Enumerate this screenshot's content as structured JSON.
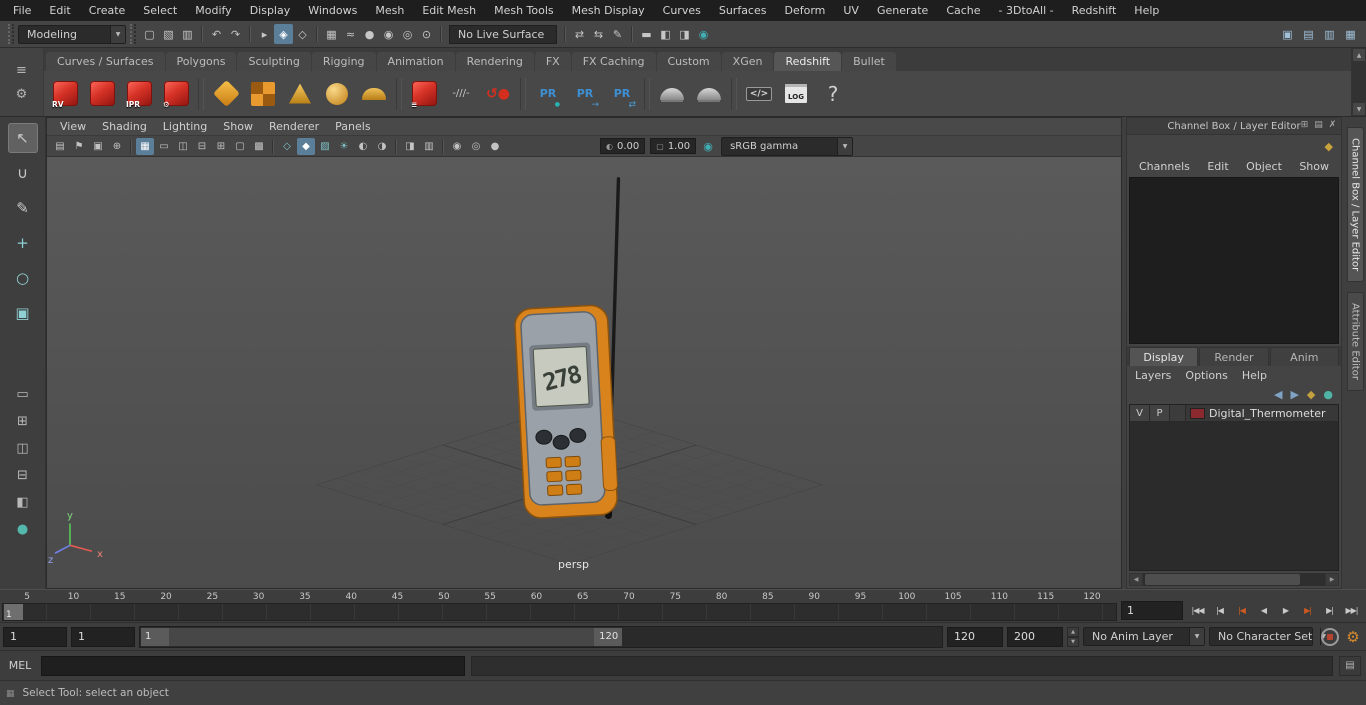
{
  "menu_bar": {
    "items": [
      "File",
      "Edit",
      "Create",
      "Select",
      "Modify",
      "Display",
      "Windows",
      "Mesh",
      "Edit Mesh",
      "Mesh Tools",
      "Mesh Display",
      "Curves",
      "Surfaces",
      "Deform",
      "UV",
      "Generate",
      "Cache",
      "- 3DtoAll -",
      "Redshift",
      "Help"
    ]
  },
  "status_line": {
    "menu_set": "Modeling",
    "live_surface": "No Live Surface",
    "icons_a": [
      {
        "name": "file-new-icon",
        "glyph": "▢"
      },
      {
        "name": "file-open-icon",
        "glyph": "▧"
      },
      {
        "name": "file-save-icon",
        "glyph": "▥"
      },
      {
        "sep": true
      },
      {
        "name": "undo-icon",
        "glyph": "↶"
      },
      {
        "name": "redo-icon",
        "glyph": "↷"
      },
      {
        "sep": true
      },
      {
        "name": "select-hierarchy-mode-icon",
        "glyph": "▸"
      },
      {
        "name": "select-object-mode-icon",
        "glyph": "◈",
        "active": true
      },
      {
        "name": "select-component-mode-icon",
        "glyph": "◇"
      },
      {
        "sep": true
      },
      {
        "name": "snap-to-grid-icon",
        "glyph": "▦"
      },
      {
        "name": "snap-to-curve-icon",
        "glyph": "≈"
      },
      {
        "name": "snap-to-point-icon",
        "glyph": "●"
      },
      {
        "name": "snap-to-projected-center-icon",
        "glyph": "◉"
      },
      {
        "name": "snap-to-view-plane-icon",
        "glyph": "◎"
      },
      {
        "name": "make-live-icon",
        "glyph": "⊙"
      },
      {
        "sep": true
      }
    ],
    "icons_b": [
      {
        "sep": true
      },
      {
        "name": "input-connections-icon",
        "glyph": "⇄"
      },
      {
        "name": "output-connections-icon",
        "glyph": "⇆"
      },
      {
        "name": "construction-history-icon",
        "glyph": "✎"
      },
      {
        "sep": true
      },
      {
        "name": "open-render-view-icon",
        "glyph": "▬"
      },
      {
        "name": "render-current-frame-icon",
        "glyph": "◧"
      },
      {
        "name": "ipr-render-icon",
        "glyph": "◨"
      },
      {
        "name": "render-settings-icon",
        "glyph": "◉",
        "color": "#3fb0b5"
      }
    ],
    "right_icons": [
      {
        "name": "toggle-modeling-toolkit-icon",
        "glyph": "▣",
        "color": "#9fc0d8"
      },
      {
        "name": "toggle-hypershade-icon",
        "glyph": "▤",
        "color": "#9fc0d8"
      },
      {
        "name": "toggle-tool-settings-icon",
        "glyph": "▥",
        "color": "#9fc0d8"
      },
      {
        "name": "toggle-channel-box-icon",
        "glyph": "▦",
        "color": "#9fc0d8"
      }
    ]
  },
  "shelf": {
    "left_icons": [
      {
        "name": "shelf-tab-menu-icon",
        "glyph": "≡"
      },
      {
        "name": "shelf-editor-gear-icon",
        "glyph": "⚙"
      }
    ],
    "tabs": [
      {
        "label": "Curves / Surfaces"
      },
      {
        "label": "Polygons"
      },
      {
        "label": "Sculpting"
      },
      {
        "label": "Rigging"
      },
      {
        "label": "Animation"
      },
      {
        "label": "Rendering"
      },
      {
        "label": "FX"
      },
      {
        "label": "FX Caching"
      },
      {
        "label": "Custom"
      },
      {
        "label": "XGen"
      },
      {
        "label": "Redshift",
        "active": true
      },
      {
        "label": "Bullet"
      }
    ],
    "icons": [
      {
        "name": "rs-render-view-icon",
        "type": "cube",
        "glyph": "RV"
      },
      {
        "name": "rs-render-snapshot-icon",
        "type": "cube",
        "glyph": ""
      },
      {
        "name": "rs-ipr-icon",
        "type": "cube",
        "glyph": "IPR"
      },
      {
        "name": "rs-render-settings-icon",
        "type": "cube",
        "glyph": "⚙"
      },
      {
        "sep": true
      },
      {
        "name": "rs-material-icon",
        "type": "diamond"
      },
      {
        "name": "rs-texture-icon",
        "type": "checker"
      },
      {
        "name": "rs-volume-light-icon",
        "type": "cone"
      },
      {
        "name": "rs-dome-light-icon",
        "type": "sphere"
      },
      {
        "name": "rs-physical-sky-icon",
        "type": "dome"
      },
      {
        "sep": true
      },
      {
        "name": "rs-proxy-export-icon",
        "type": "cube",
        "glyph": "≡"
      },
      {
        "name": "rs-curves-icon",
        "type": "slashes",
        "glyph": "-///-"
      },
      {
        "name": "rs-sss-icon",
        "type": "curl",
        "glyph": "↺●"
      },
      {
        "sep": true
      },
      {
        "name": "pr-import-icon",
        "type": "pr",
        "glyph": "PR"
      },
      {
        "name": "pr-export-icon",
        "type": "pr-export",
        "glyph": "PR"
      },
      {
        "name": "pr-convert-icon",
        "type": "pr-swap",
        "glyph": "PR"
      },
      {
        "sep": true
      },
      {
        "name": "bake-lightmap-icon",
        "type": "dome-gray"
      },
      {
        "name": "bake-vertex-icon",
        "type": "dome-gray"
      },
      {
        "sep": true
      },
      {
        "name": "script-snippet-icon",
        "type": "code",
        "glyph": "</>"
      },
      {
        "name": "log-viewer-icon",
        "type": "log",
        "glyph": "LOG"
      },
      {
        "name": "redshift-help-icon",
        "type": "help",
        "glyph": "?"
      }
    ]
  },
  "toolbox": {
    "tools": [
      {
        "name": "select-tool",
        "glyph": "↖",
        "active": true
      },
      {
        "name": "lasso-select-tool",
        "glyph": "∪"
      },
      {
        "name": "paint-select-tool",
        "glyph": "✎"
      },
      {
        "name": "move-tool",
        "glyph": "+",
        "color": "#8fd0d4"
      },
      {
        "name": "rotate-tool",
        "glyph": "○",
        "color": "#8fd0d4"
      },
      {
        "name": "scale-tool",
        "glyph": "▣",
        "color": "#8fd0d4"
      }
    ],
    "layouts": [
      {
        "name": "layout-single-pane-button",
        "glyph": "▭"
      },
      {
        "name": "layout-four-pane-button",
        "glyph": "⊞"
      },
      {
        "name": "layout-two-pane-side-button",
        "glyph": "◫"
      },
      {
        "name": "layout-two-pane-stacked-button",
        "glyph": "⊟"
      },
      {
        "name": "layout-persp-outliner-button",
        "glyph": "◧"
      },
      {
        "name": "outliner-panel-button",
        "glyph": "●",
        "color": "#55b8ad"
      }
    ]
  },
  "panel_menu": {
    "items": [
      "View",
      "Shading",
      "Lighting",
      "Show",
      "Renderer",
      "Panels"
    ]
  },
  "viewport": {
    "toolbar_icons": [
      {
        "name": "camera-attributes-icon",
        "glyph": "▤"
      },
      {
        "name": "camera-bookmarks-icon",
        "glyph": "⚑"
      },
      {
        "name": "image-plane-icon",
        "glyph": "▣"
      },
      {
        "name": "two-d-pan-zoom-icon",
        "glyph": "⊕"
      },
      {
        "sep": true
      },
      {
        "name": "grid-toggle-icon",
        "glyph": "▦",
        "active": true
      },
      {
        "name": "film-gate-icon",
        "glyph": "▭"
      },
      {
        "name": "resolution-gate-icon",
        "glyph": "◫"
      },
      {
        "name": "gate-mask-icon",
        "glyph": "⊟"
      },
      {
        "name": "field-chart-icon",
        "glyph": "⊞"
      },
      {
        "name": "safe-action-icon",
        "glyph": "▢"
      },
      {
        "name": "safe-title-icon",
        "glyph": "▩"
      },
      {
        "sep": true
      },
      {
        "name": "wireframe-mode-icon",
        "glyph": "◇",
        "color": "#7fc4c9"
      },
      {
        "name": "shaded-mode-icon",
        "glyph": "◆",
        "color": "#7fc4c9",
        "active": true
      },
      {
        "name": "textured-mode-icon",
        "glyph": "▨",
        "color": "#7fc4c9"
      },
      {
        "name": "use-all-lights-icon",
        "glyph": "☀",
        "color": "#7fc4c9"
      },
      {
        "name": "shadows-icon",
        "glyph": "◐"
      },
      {
        "name": "screen-space-ao-icon",
        "glyph": "◑"
      },
      {
        "sep": true
      },
      {
        "name": "isolate-select-icon",
        "glyph": "◨"
      },
      {
        "name": "xray-icon",
        "glyph": "▥"
      },
      {
        "sep": true
      },
      {
        "name": "motion-blur-icon",
        "glyph": "◉"
      },
      {
        "name": "multisample-aa-icon",
        "glyph": "◎"
      },
      {
        "name": "depth-of-field-icon",
        "glyph": "●"
      }
    ],
    "exposure": "0.00",
    "gamma": "1.00",
    "view_transform": "sRGB gamma",
    "camera_label": "persp",
    "lcd_value": "278",
    "axis_x": "x",
    "axis_y": "y",
    "axis_z": "z"
  },
  "channel_box": {
    "title": "Channel Box / Layer Editor",
    "titlebar_icons": [
      {
        "name": "panel-pop-out-icon",
        "glyph": "⊞"
      },
      {
        "name": "panel-options-icon",
        "glyph": "▤"
      },
      {
        "name": "panel-close-icon",
        "glyph": "✗"
      }
    ],
    "filter_icons": [
      {
        "name": "channel-display-speed-icon",
        "glyph": "◆",
        "color": "#c8a23c"
      }
    ],
    "menus": [
      "Channels",
      "Edit",
      "Object",
      "Show"
    ],
    "layer_editor": {
      "tabs": [
        {
          "label": "Display",
          "active": true
        },
        {
          "label": "Render"
        },
        {
          "label": "Anim"
        }
      ],
      "menus": [
        "Layers",
        "Options",
        "Help"
      ],
      "icons": [
        {
          "name": "layer-move-up-icon",
          "glyph": "◀",
          "color": "#7fa3c4"
        },
        {
          "name": "layer-move-down-icon",
          "glyph": "▶",
          "color": "#7fa3c4"
        },
        {
          "name": "new-empty-layer-icon",
          "glyph": "◆",
          "color": "#c2a23e"
        },
        {
          "name": "new-layer-from-selected-icon",
          "glyph": "●",
          "color": "#4fb3a5"
        }
      ],
      "layers": [
        {
          "visible": "V",
          "playback": "P",
          "name": "Digital_Thermometer",
          "color": "#8b2a2e"
        }
      ]
    }
  },
  "side_tabs": [
    {
      "label": "Channel Box / Layer Editor",
      "active": true
    },
    {
      "label": "Attribute Editor"
    }
  ],
  "time_slider": {
    "ticks": [
      "5",
      "10",
      "15",
      "20",
      "25",
      "30",
      "35",
      "40",
      "45",
      "50",
      "55",
      "60",
      "65",
      "70",
      "75",
      "80",
      "85",
      "90",
      "95",
      "100",
      "105",
      "110",
      "115",
      "120"
    ],
    "current_frame": "1",
    "frame_field": "1",
    "transport": [
      {
        "name": "go-to-start-button",
        "glyph": "|◀◀"
      },
      {
        "name": "step-back-frame-button",
        "glyph": "|◀"
      },
      {
        "name": "step-back-key-button",
        "glyph": "|◀",
        "color": "#cf5a20"
      },
      {
        "name": "play-backwards-button",
        "glyph": "◀"
      },
      {
        "name": "play-forwards-button",
        "glyph": "▶"
      },
      {
        "name": "step-forward-key-button",
        "glyph": "▶|",
        "color": "#cf5a20"
      },
      {
        "name": "step-forward-frame-button",
        "glyph": "▶|"
      },
      {
        "name": "go-to-end-button",
        "glyph": "▶▶|"
      }
    ]
  },
  "range_slider": {
    "animation_start": "1",
    "playback_start": "1",
    "bar_start": "1",
    "bar_end": "120",
    "playback_end": "120",
    "animation_end": "200",
    "anim_layer": "No Anim Layer",
    "character_set": "No Character Set"
  },
  "command_line": {
    "label": "MEL"
  },
  "help_line": {
    "text": "Select Tool: select an object"
  }
}
